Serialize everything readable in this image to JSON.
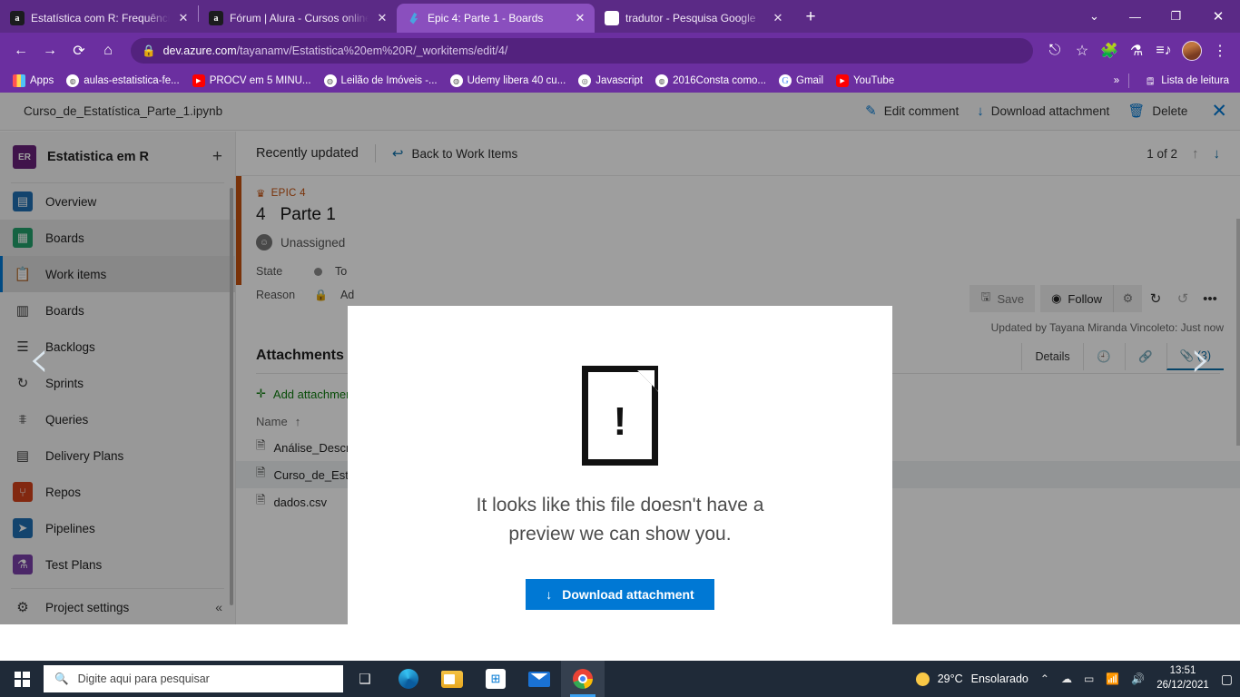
{
  "browser": {
    "tabs": [
      {
        "title": "Estatística com R: Frequências e ...",
        "icon": "alura-favicon",
        "active": false
      },
      {
        "title": "Fórum | Alura - Cursos online de ...",
        "icon": "alura-favicon",
        "active": false
      },
      {
        "title": "Epic 4: Parte 1 - Boards",
        "icon": "azure-devops-favicon",
        "active": true
      },
      {
        "title": "tradutor - Pesquisa Google",
        "icon": "google-favicon",
        "active": false
      }
    ],
    "new_tab_label": "+",
    "window_controls": {
      "dropdown": "⌄",
      "minimize": "—",
      "maximize": "❐",
      "close": "✕"
    },
    "nav": {
      "back": "←",
      "forward": "→",
      "reload": "⟳",
      "home": "⌂"
    },
    "address": {
      "lock": "🔒",
      "host": "dev.azure.com",
      "path": "/tayanamv/Estatistica%20em%20R/_workitems/edit/4/"
    },
    "toolbar_icons": [
      "share-icon",
      "bookmark-star-icon",
      "extensions-icon",
      "labs-beaker-icon",
      "reading-list-icon",
      "profile-avatar",
      "chrome-menu-icon"
    ],
    "bookmarks": [
      {
        "label": "Apps",
        "icon": "apps-grid-icon"
      },
      {
        "label": "aulas-estatistica-fe...",
        "icon": "globe-icon"
      },
      {
        "label": "PROCV em 5 MINU...",
        "icon": "youtube-icon"
      },
      {
        "label": "Leilão de Imóveis -...",
        "icon": "globe-icon"
      },
      {
        "label": "Udemy libera 40 cu...",
        "icon": "globe-icon"
      },
      {
        "label": "Javascript",
        "icon": "globe-icon"
      },
      {
        "label": "2016Consta como...",
        "icon": "globe-icon"
      },
      {
        "label": "Gmail",
        "icon": "google-icon"
      },
      {
        "label": "YouTube",
        "icon": "youtube-icon"
      }
    ],
    "bookmarks_overflow": "»",
    "reading_list": "Lista de leitura"
  },
  "attachment_bar": {
    "filename": "Curso_de_Estatística_Parte_1.ipynb",
    "actions": [
      {
        "label": "Edit comment",
        "icon": "pencil-icon"
      },
      {
        "label": "Download attachment",
        "icon": "download-arrow-icon"
      },
      {
        "label": "Delete",
        "icon": "trash-icon"
      }
    ],
    "close": "✕"
  },
  "sidebar": {
    "project_initials": "ER",
    "project_name": "Estatistica em R",
    "add_label": "+",
    "items": [
      {
        "label": "Overview",
        "icon": "overview-icon",
        "state": "normal"
      },
      {
        "label": "Boards",
        "icon": "boards-hub-icon",
        "state": "highlight"
      },
      {
        "label": "Work items",
        "icon": "work-items-clipboard-icon",
        "state": "selected"
      },
      {
        "label": "Boards",
        "icon": "boards-grid-icon",
        "state": "normal"
      },
      {
        "label": "Backlogs",
        "icon": "backlogs-list-icon",
        "state": "normal"
      },
      {
        "label": "Sprints",
        "icon": "sprints-cycle-icon",
        "state": "normal"
      },
      {
        "label": "Queries",
        "icon": "queries-filter-icon",
        "state": "normal"
      },
      {
        "label": "Delivery Plans",
        "icon": "delivery-plans-icon",
        "state": "normal"
      },
      {
        "label": "Repos",
        "icon": "repos-icon",
        "state": "normal"
      },
      {
        "label": "Pipelines",
        "icon": "pipelines-rocket-icon",
        "state": "normal"
      },
      {
        "label": "Test Plans",
        "icon": "test-plans-flask-icon",
        "state": "normal"
      }
    ],
    "settings": {
      "label": "Project settings",
      "icon": "gear-icon",
      "collapse": "«"
    }
  },
  "main": {
    "breadcrumb": "Recently updated",
    "back_link": "Back to Work Items",
    "pager": {
      "text": "1 of 2",
      "up": "↑",
      "down": "↓"
    },
    "work_item": {
      "type_label": "EPIC 4",
      "type_icon": "crown-icon",
      "id": "4",
      "title": "Parte 1",
      "assigned_to": "Unassigned",
      "fields": [
        {
          "label": "State",
          "value": "To"
        },
        {
          "label": "Reason",
          "value": "Ad"
        }
      ],
      "buttons": {
        "save": "Save",
        "follow": "Follow",
        "gear": "gear-icon",
        "refresh": "refresh-icon",
        "revert": "revert-icon",
        "more": "•••"
      },
      "updated_by": "Updated by Tayana Miranda Vincoleto: Just now",
      "tabs": [
        {
          "label": "Details",
          "active": false
        },
        {
          "label": "history-icon",
          "active": false
        },
        {
          "label": "links-icon",
          "active": false
        },
        {
          "label": "(3)",
          "active": true
        }
      ]
    },
    "attachments": {
      "heading": "Attachments",
      "add_label": "Add attachment",
      "column_header": "Name",
      "sort_arrow": "↑",
      "files": [
        {
          "name": "Análise_Descr",
          "selected": false
        },
        {
          "name": "Curso_de_Esta",
          "selected": true
        },
        {
          "name": "dados.csv",
          "selected": false
        }
      ]
    }
  },
  "preview_modal": {
    "icon": "file-no-preview-icon",
    "message_line1": "It looks like this file doesn't have a",
    "message_line2": "preview we can show you.",
    "download_button": "Download attachment",
    "download_icon": "download-arrow-icon",
    "prev_arrow": "‹",
    "next_arrow": "›"
  },
  "taskbar": {
    "start_icon": "windows-logo-icon",
    "search_placeholder": "Digite aqui para pesquisar",
    "search_icon": "search-icon",
    "apps": [
      {
        "name": "task-view-icon",
        "active": false
      },
      {
        "name": "edge-icon",
        "active": false
      },
      {
        "name": "file-explorer-icon",
        "active": false
      },
      {
        "name": "microsoft-store-icon",
        "active": false
      },
      {
        "name": "mail-icon",
        "active": false
      },
      {
        "name": "chrome-icon",
        "active": true
      }
    ],
    "weather": {
      "temp": "29°C",
      "condition": "Ensolarado",
      "icon": "sun-icon"
    },
    "tray_icons": [
      "chevron-up-icon",
      "onedrive-icon",
      "battery-icon",
      "wifi-icon",
      "volume-icon"
    ],
    "time": "13:51",
    "date": "26/12/2021",
    "notification_icon": "action-center-icon"
  },
  "colors": {
    "browser_purple": "#6b2fa0",
    "tabstrip_purple": "#5b2a86",
    "accent_blue": "#0078d4",
    "epic_orange": "#c4520f",
    "taskbar": "#1f2a38"
  }
}
